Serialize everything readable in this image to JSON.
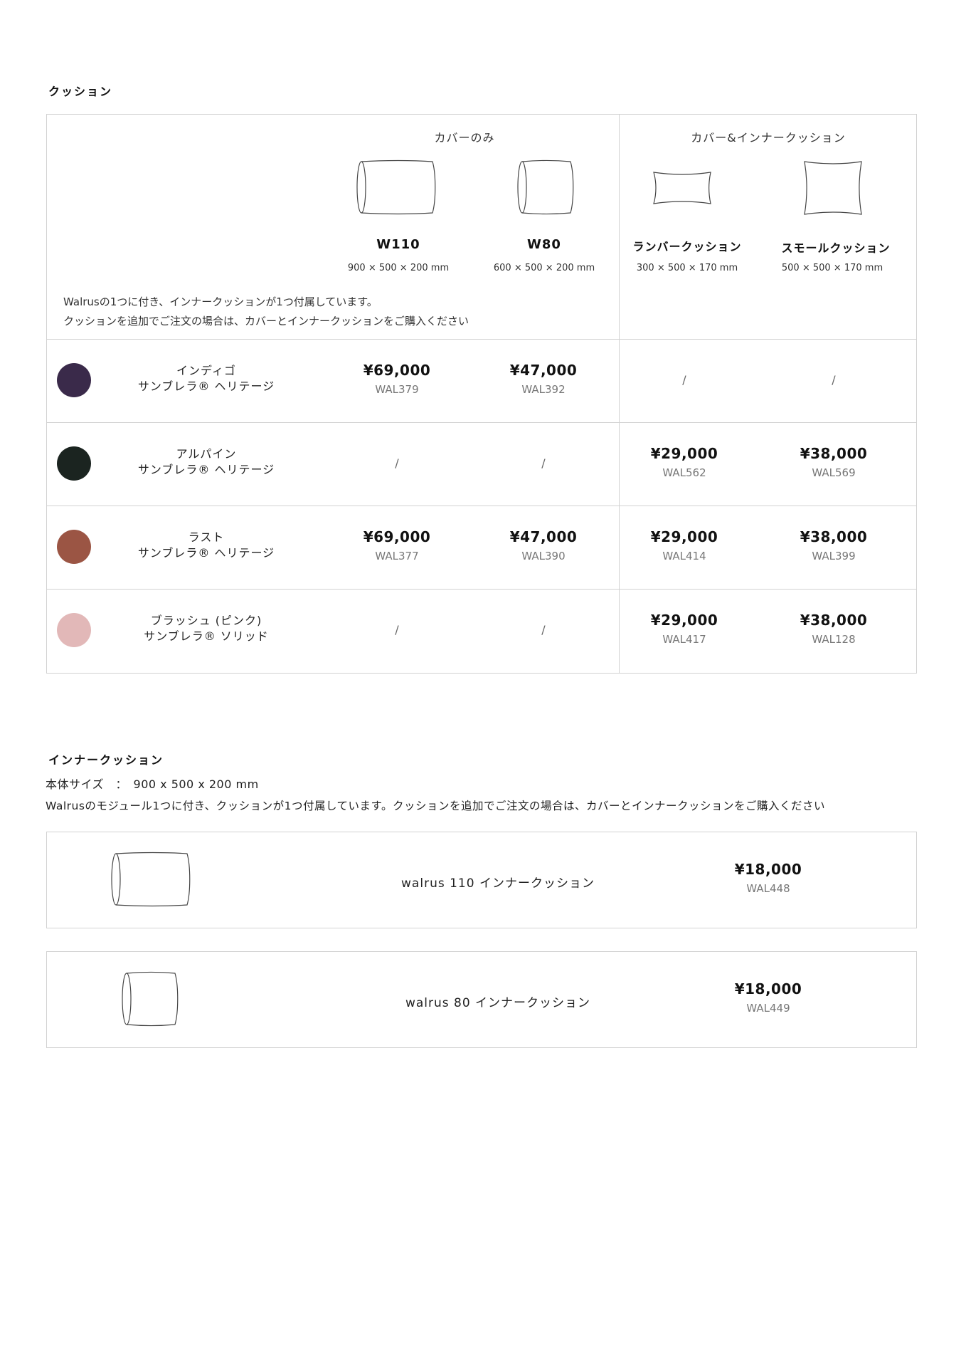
{
  "cushion": {
    "title": "クッション",
    "group_cover_only": "カバーのみ",
    "group_cover_inner": "カバー&インナークッション",
    "columns": [
      {
        "name": "W110",
        "dims": "900 × 500 × 200 mm",
        "icon": "pillow-long-icon"
      },
      {
        "name": "W80",
        "dims": "600 × 500 × 200 mm",
        "icon": "pillow-short-icon"
      },
      {
        "name": "ランバークッション",
        "dims": "300 × 500 × 170 mm",
        "icon": "lumbar-cushion-icon"
      },
      {
        "name": "スモールクッション",
        "dims": "500 × 500 × 170 mm",
        "icon": "small-cushion-icon"
      }
    ],
    "note_line1": "Walrusの1つに付き、インナークッションが1つ付属しています。",
    "note_line2": "クッションを追加でご注文の場合は、カバーとインナークッションをご購入ください",
    "rows": [
      {
        "name1": "インディゴ",
        "name2": "サンブレラ® ヘリテージ",
        "swatch": "#3a2a4a",
        "cells": [
          {
            "price": "¥69,000",
            "code": "WAL379"
          },
          {
            "price": "¥47,000",
            "code": "WAL392"
          },
          {
            "slash": "/"
          },
          {
            "slash": "/"
          }
        ]
      },
      {
        "name1": "アルパイン",
        "name2": "サンブレラ® ヘリテージ",
        "swatch": "#1b2420",
        "cells": [
          {
            "slash": "/"
          },
          {
            "slash": "/"
          },
          {
            "price": "¥29,000",
            "code": "WAL562"
          },
          {
            "price": "¥38,000",
            "code": "WAL569"
          }
        ]
      },
      {
        "name1": "ラスト",
        "name2": "サンブレラ® ヘリテージ",
        "swatch": "#9b5544",
        "cells": [
          {
            "price": "¥69,000",
            "code": "WAL377"
          },
          {
            "price": "¥47,000",
            "code": "WAL390"
          },
          {
            "price": "¥29,000",
            "code": "WAL414"
          },
          {
            "price": "¥38,000",
            "code": "WAL399"
          }
        ]
      },
      {
        "name1": "ブラッシュ (ピンク)",
        "name2": "サンブレラ® ソリッド",
        "swatch": "#e2b8b8",
        "cells": [
          {
            "slash": "/"
          },
          {
            "slash": "/"
          },
          {
            "price": "¥29,000",
            "code": "WAL417"
          },
          {
            "price": "¥38,000",
            "code": "WAL128"
          }
        ]
      }
    ]
  },
  "inner": {
    "title": "インナークッション",
    "size_text": "本体サイズ　：　900 x 500 x 200 mm",
    "desc": "Walrusのモジュール1つに付き、クッションが1つ付属しています。クッションを追加でご注文の場合は、カバーとインナークッションをご購入ください",
    "items": [
      {
        "name": "walrus 110 インナークッション",
        "price": "¥18,000",
        "code": "WAL448"
      },
      {
        "name": "walrus 80 インナークッション",
        "price": "¥18,000",
        "code": "WAL449"
      }
    ]
  }
}
